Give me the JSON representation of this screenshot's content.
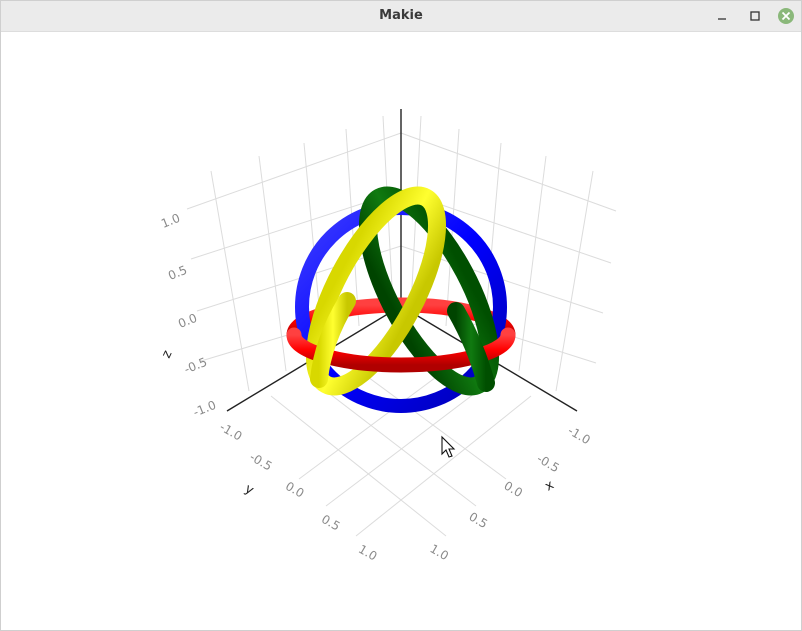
{
  "window": {
    "title": "Makie"
  },
  "titlebar_icons": {
    "minimize": "minimize-icon",
    "maximize": "maximize-icon",
    "close": "close-icon"
  },
  "axes": {
    "x_label": "x",
    "y_label": "y",
    "z_label": "z",
    "x_ticks": [
      "-1.0",
      "-0.5",
      "0.0",
      "0.5",
      "1.0"
    ],
    "y_ticks": [
      "-1.0",
      "-0.5",
      "0.0",
      "0.5",
      "1.0"
    ],
    "z_ticks": [
      "1.0",
      "0.5",
      "0.0",
      "-0.5",
      "-1.0"
    ]
  },
  "rings": [
    {
      "name": "blue-ring",
      "color": "#0000ff"
    },
    {
      "name": "red-ring",
      "color": "#ff0000"
    },
    {
      "name": "yellow-ring",
      "color": "#ffff00"
    },
    {
      "name": "green-ring",
      "color": "#006400"
    }
  ],
  "cursor": {
    "icon": "mouse-pointer-icon"
  }
}
